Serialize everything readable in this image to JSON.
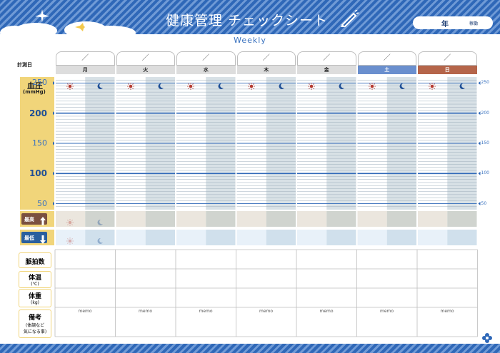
{
  "header": {
    "title": "健康管理 チェックシート",
    "subtitle": "Weekly",
    "year_label": "年",
    "age_label": "稼働"
  },
  "row_labels": {
    "date": "計測日",
    "blood_pressure": "血圧",
    "bp_unit": "(mmHg)",
    "max": "最高",
    "min": "最低",
    "pulse": "脈拍数",
    "temp": "体温",
    "temp_unit": "(℃)",
    "weight": "体重",
    "weight_unit": "(kg)",
    "notes": "備考",
    "notes_sub1": "(体調など",
    "notes_sub2": "気になる事)"
  },
  "date_placeholder": "／",
  "days": [
    {
      "label": "月",
      "color": "#dddddd",
      "text_color": "#222222"
    },
    {
      "label": "火",
      "color": "#dddddd",
      "text_color": "#222222"
    },
    {
      "label": "水",
      "color": "#dddddd",
      "text_color": "#222222"
    },
    {
      "label": "木",
      "color": "#dddddd",
      "text_color": "#222222"
    },
    {
      "label": "金",
      "color": "#dddddd",
      "text_color": "#222222"
    },
    {
      "label": "土",
      "color": "#6a8fce",
      "text_color": "#ffffff"
    },
    {
      "label": "日",
      "color": "#b5654a",
      "text_color": "#ffffff"
    }
  ],
  "period_icons": {
    "morning": "sun-icon",
    "evening": "moon-icon"
  },
  "y_axis": {
    "ticks": [
      250,
      200,
      150,
      100,
      50
    ],
    "left_labels": [
      "250",
      "200",
      "150",
      "100",
      "50"
    ],
    "right_labels": [
      "250",
      "200",
      "150",
      "100",
      "50"
    ],
    "min": 40,
    "max": 260,
    "minor_step": 5,
    "major_values": [
      200,
      100
    ]
  },
  "memo_label": "memo",
  "colors": {
    "brand_blue": "#2f68b8",
    "yellow": "#f1d57a",
    "max_badge": "#7a5040",
    "min_badge": "#2a5f9e"
  }
}
